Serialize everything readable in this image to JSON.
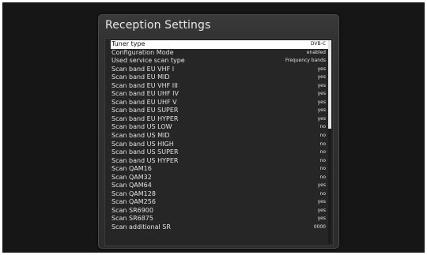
{
  "window": {
    "title": "Reception Settings"
  },
  "settings": [
    {
      "label": "Tuner type",
      "value": "DVB-C"
    },
    {
      "label": "Configuration Mode",
      "value": "enabled"
    },
    {
      "label": "Used service scan type",
      "value": "Frequency bands"
    },
    {
      "label": "Scan band EU VHF I",
      "value": "yes"
    },
    {
      "label": "Scan band EU MID",
      "value": "yes"
    },
    {
      "label": "Scan band EU VHF III",
      "value": "yes"
    },
    {
      "label": "Scan band EU UHF IV",
      "value": "yes"
    },
    {
      "label": "Scan band EU UHF V",
      "value": "yes"
    },
    {
      "label": "Scan band EU SUPER",
      "value": "yes"
    },
    {
      "label": "Scan band EU HYPER",
      "value": "yes"
    },
    {
      "label": "Scan band US LOW",
      "value": "no"
    },
    {
      "label": "Scan band US MID",
      "value": "no"
    },
    {
      "label": "Scan band US HIGH",
      "value": "no"
    },
    {
      "label": "Scan band US SUPER",
      "value": "no"
    },
    {
      "label": "Scan band US HYPER",
      "value": "no"
    },
    {
      "label": "Scan QAM16",
      "value": "no"
    },
    {
      "label": "Scan QAM32",
      "value": "no"
    },
    {
      "label": "Scan QAM64",
      "value": "yes"
    },
    {
      "label": "Scan QAM128",
      "value": "no"
    },
    {
      "label": "Scan QAM256",
      "value": "yes"
    },
    {
      "label": "Scan SR6900",
      "value": "yes"
    },
    {
      "label": "Scan SR6875",
      "value": "yes"
    },
    {
      "label": "Scan additional SR",
      "value": "0000"
    }
  ],
  "selected_index": 0,
  "scroll_fraction_visible": 0.43,
  "colors": {
    "background": "#161616",
    "panel": "#323232",
    "selection": "#ffffff",
    "text": "#e2e2e2"
  }
}
